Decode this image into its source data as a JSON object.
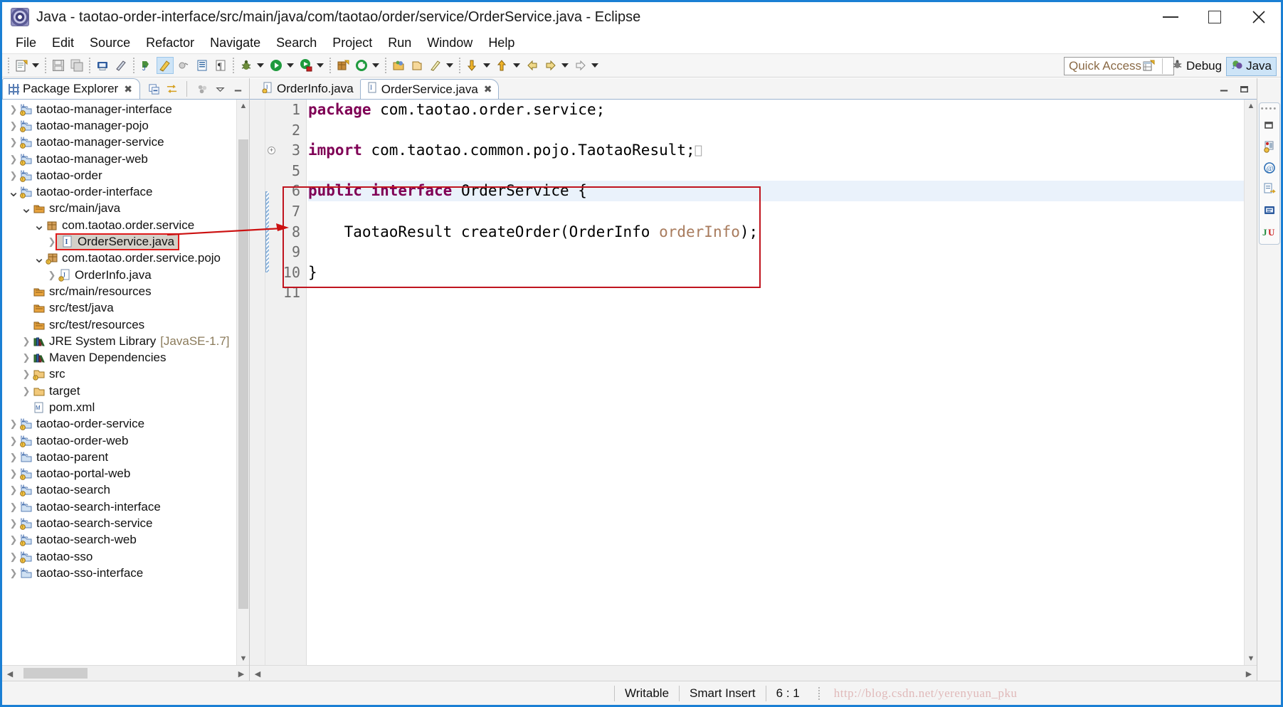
{
  "window": {
    "title": "Java - taotao-order-interface/src/main/java/com/taotao/order/service/OrderService.java - Eclipse",
    "app_icon": "eclipse-icon",
    "minimize_label": "Minimize",
    "maximize_label": "Maximize",
    "close_label": "Close"
  },
  "menubar": {
    "items": [
      {
        "label": "File"
      },
      {
        "label": "Edit"
      },
      {
        "label": "Source"
      },
      {
        "label": "Refactor"
      },
      {
        "label": "Navigate"
      },
      {
        "label": "Search"
      },
      {
        "label": "Project"
      },
      {
        "label": "Run"
      },
      {
        "label": "Window"
      },
      {
        "label": "Help"
      }
    ]
  },
  "toolbar": {
    "quick_access_placeholder": "Quick Access",
    "quick_access_value": "",
    "open_perspective_label": "Open Perspective",
    "perspectives": [
      {
        "label": "Debug",
        "selected": false,
        "icon": "debug-icon"
      },
      {
        "label": "Java",
        "selected": true,
        "icon": "java-perspective-icon"
      }
    ]
  },
  "package_explorer": {
    "tab_label": "Package Explorer",
    "tab_icon": "package-explorer-icon",
    "tools": [
      "collapse-all-icon",
      "link-with-editor-icon",
      "view-menu-icon",
      "minimize-icon",
      "maximize-icon"
    ],
    "tree": [
      {
        "label": "taotao-manager-interface",
        "indent": 0,
        "twisty": "collapsed",
        "icon": "maven-project-warn-icon"
      },
      {
        "label": "taotao-manager-pojo",
        "indent": 0,
        "twisty": "collapsed",
        "icon": "maven-project-warn-icon"
      },
      {
        "label": "taotao-manager-service",
        "indent": 0,
        "twisty": "collapsed",
        "icon": "maven-project-warn-icon"
      },
      {
        "label": "taotao-manager-web",
        "indent": 0,
        "twisty": "collapsed",
        "icon": "maven-project-warn-icon"
      },
      {
        "label": "taotao-order",
        "indent": 0,
        "twisty": "collapsed",
        "icon": "maven-project-warn-icon"
      },
      {
        "label": "taotao-order-interface",
        "indent": 0,
        "twisty": "expanded",
        "icon": "maven-project-warn-icon"
      },
      {
        "label": "src/main/java",
        "indent": 1,
        "twisty": "expanded",
        "icon": "source-folder-icon"
      },
      {
        "label": "com.taotao.order.service",
        "indent": 2,
        "twisty": "expanded",
        "icon": "package-icon"
      },
      {
        "label": "OrderService.java",
        "indent": 3,
        "twisty": "collapsed",
        "icon": "interface-file-icon",
        "highlighted": true
      },
      {
        "label": "com.taotao.order.service.pojo",
        "indent": 2,
        "twisty": "expanded",
        "icon": "package-warn-icon"
      },
      {
        "label": "OrderInfo.java",
        "indent": 3,
        "twisty": "collapsed",
        "icon": "class-file-warn-icon"
      },
      {
        "label": "src/main/resources",
        "indent": 1,
        "twisty": "none",
        "icon": "source-folder-icon"
      },
      {
        "label": "src/test/java",
        "indent": 1,
        "twisty": "none",
        "icon": "source-folder-icon"
      },
      {
        "label": "src/test/resources",
        "indent": 1,
        "twisty": "none",
        "icon": "source-folder-icon"
      },
      {
        "label": "JRE System Library",
        "suffix": "[JavaSE-1.7]",
        "indent": 1,
        "twisty": "collapsed",
        "icon": "library-icon"
      },
      {
        "label": "Maven Dependencies",
        "indent": 1,
        "twisty": "collapsed",
        "icon": "library-icon"
      },
      {
        "label": "src",
        "indent": 1,
        "twisty": "collapsed",
        "icon": "folder-warn-icon"
      },
      {
        "label": "target",
        "indent": 1,
        "twisty": "collapsed",
        "icon": "folder-icon"
      },
      {
        "label": "pom.xml",
        "indent": 1,
        "twisty": "none",
        "icon": "maven-pom-icon"
      },
      {
        "label": "taotao-order-service",
        "indent": 0,
        "twisty": "collapsed",
        "icon": "maven-project-warn-icon"
      },
      {
        "label": "taotao-order-web",
        "indent": 0,
        "twisty": "collapsed",
        "icon": "maven-project-warn-icon"
      },
      {
        "label": "taotao-parent",
        "indent": 0,
        "twisty": "collapsed",
        "icon": "maven-project-icon"
      },
      {
        "label": "taotao-portal-web",
        "indent": 0,
        "twisty": "collapsed",
        "icon": "maven-project-warn-icon"
      },
      {
        "label": "taotao-search",
        "indent": 0,
        "twisty": "collapsed",
        "icon": "maven-project-warn-icon"
      },
      {
        "label": "taotao-search-interface",
        "indent": 0,
        "twisty": "collapsed",
        "icon": "maven-project-icon"
      },
      {
        "label": "taotao-search-service",
        "indent": 0,
        "twisty": "collapsed",
        "icon": "maven-project-warn-icon"
      },
      {
        "label": "taotao-search-web",
        "indent": 0,
        "twisty": "collapsed",
        "icon": "maven-project-warn-icon"
      },
      {
        "label": "taotao-sso",
        "indent": 0,
        "twisty": "collapsed",
        "icon": "maven-project-warn-icon"
      },
      {
        "label": "taotao-sso-interface",
        "indent": 0,
        "twisty": "collapsed",
        "icon": "maven-project-icon"
      }
    ]
  },
  "editor": {
    "tabs": [
      {
        "label": "OrderInfo.java",
        "selected": false,
        "icon": "class-file-warn-icon",
        "closable": false
      },
      {
        "label": "OrderService.java",
        "selected": true,
        "icon": "interface-file-icon",
        "closable": true
      }
    ],
    "lines": [
      {
        "num": "1",
        "segments": [
          {
            "t": "package",
            "c": "kw"
          },
          {
            "t": " com.taotao.order.service;",
            "c": ""
          }
        ]
      },
      {
        "num": "2",
        "segments": [
          {
            "t": "",
            "c": ""
          }
        ]
      },
      {
        "num": "3",
        "fold": "collapsed",
        "segments": [
          {
            "t": "import",
            "c": "kw"
          },
          {
            "t": " com.taotao.common.pojo.TaotaoResult;",
            "c": ""
          },
          {
            "t": "⎕",
            "c": "fold-marker"
          }
        ]
      },
      {
        "num": "5",
        "segments": [
          {
            "t": "",
            "c": ""
          }
        ]
      },
      {
        "num": "6",
        "selected": true,
        "segments": [
          {
            "t": "public interface",
            "c": "kw"
          },
          {
            "t": " OrderService {",
            "c": ""
          }
        ]
      },
      {
        "num": "7",
        "segments": [
          {
            "t": "",
            "c": ""
          }
        ]
      },
      {
        "num": "8",
        "segments": [
          {
            "t": "    TaotaoResult createOrder(OrderInfo ",
            "c": ""
          },
          {
            "t": "orderInfo",
            "c": "param"
          },
          {
            "t": ");",
            "c": ""
          }
        ]
      },
      {
        "num": "9",
        "segments": [
          {
            "t": "",
            "c": ""
          }
        ]
      },
      {
        "num": "10",
        "segments": [
          {
            "t": "}",
            "c": ""
          }
        ]
      },
      {
        "num": "11",
        "segments": [
          {
            "t": "",
            "c": ""
          }
        ]
      }
    ]
  },
  "fastview": {
    "icons": [
      "restore-icon",
      "servers-warn-icon",
      "at-icon",
      "document-export-icon",
      "console-icon",
      "junit-icon"
    ]
  },
  "statusbar": {
    "writable": "Writable",
    "insert_mode": "Smart Insert",
    "cursor_position": "6 : 1",
    "watermark": "http://blog.csdn.net/yerenyuan_pku"
  },
  "colors": {
    "window_border": "#1a7fd4",
    "keyword": "#7f0055",
    "parameter": "#a87b5d",
    "selection_line": "#eaf2fb",
    "annotation_red": "#c0141e",
    "highlight_bg": "#d4d0c8",
    "perspective_selected": "#cde4f7"
  }
}
